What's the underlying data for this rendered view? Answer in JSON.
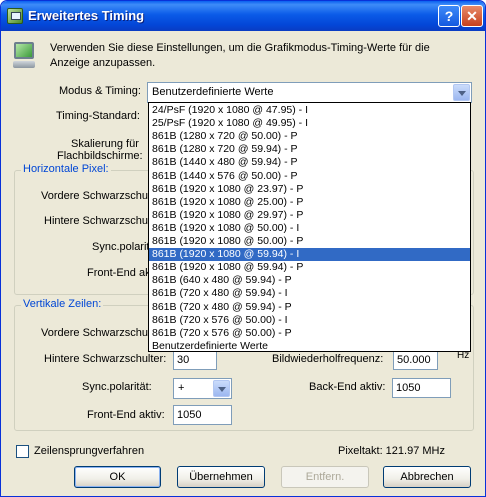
{
  "window": {
    "title": "Erweitertes Timing",
    "help_glyph": "?",
    "close_glyph": "✕",
    "app_icon": "display-settings-icon",
    "info_icon": "monitor-icon"
  },
  "intro": "Verwenden Sie diese Einstellungen, um die Grafikmodus-Timing-Werte für die Anzeige anzupassen.",
  "fields": {
    "mode_label": "Modus & Timing:",
    "mode_value": "Benutzerdefinierte Werte",
    "standard_label": "Timing-Standard:",
    "scaling_label_1": "Skalierung für",
    "scaling_label_2": "Flachbildschirme:"
  },
  "horizontal": {
    "title": "Horizontale Pixel:",
    "front_porch": "Vordere Schwarzschul",
    "back_porch": "Hintere Schwarzschul",
    "sync_polarity": "Sync.polarit",
    "front_end": "Front-End akt"
  },
  "vertical": {
    "title": "Vertikale Zeilen:",
    "front_porch": "Vordere Schwarzschul",
    "back_porch_label": "Hintere Schwarzschulter:",
    "back_porch_value": "30",
    "sync_polarity_label": "Sync.polarität:",
    "sync_polarity_value": "+",
    "front_end_label": "Front-End aktiv:",
    "front_end_value": "1050",
    "refresh_label": "Bildwiederholfrequenz:",
    "refresh_value": "50.000",
    "refresh_unit": "Hz",
    "back_end_label": "Back-End aktiv:",
    "back_end_value": "1050"
  },
  "dropdown": {
    "selected_index": 11,
    "options": [
      "24/PsF  (1920 x 1080 @ 47.95) - I",
      "25/PsF  (1920 x 1080 @ 49.95) - I",
      "861B  (1280 x 720 @ 50.00) - P",
      "861B  (1280 x 720 @ 59.94) - P",
      "861B  (1440 x 480 @ 59.94) - P",
      "861B  (1440 x 576 @ 50.00) - P",
      "861B  (1920 x 1080 @ 23.97) - P",
      "861B  (1920 x 1080 @ 25.00) - P",
      "861B  (1920 x 1080 @ 29.97) - P",
      "861B  (1920 x 1080 @ 50.00) - I",
      "861B  (1920 x 1080 @ 50.00) - P",
      "861B  (1920 x 1080 @ 59.94) - I",
      "861B  (1920 x 1080 @ 59.94) - P",
      "861B  (640 x 480 @ 59.94) - P",
      "861B  (720 x 480 @ 59.94) - I",
      "861B  (720 x 480 @ 59.94) - P",
      "861B  (720 x 576 @ 50.00) - I",
      "861B  (720 x 576 @ 50.00) - P",
      "Benutzerdefinierte Werte"
    ]
  },
  "interlace_label": "Zeilensprungverfahren",
  "pixel_clock": "Pixeltakt:  121.97 MHz",
  "buttons": {
    "ok": "OK",
    "apply": "Übernehmen",
    "remove": "Entfern.",
    "cancel": "Abbrechen"
  },
  "colors": {
    "selection": "#316ac5",
    "group_title": "#0046d5",
    "titlebar": "#0b5be8"
  }
}
